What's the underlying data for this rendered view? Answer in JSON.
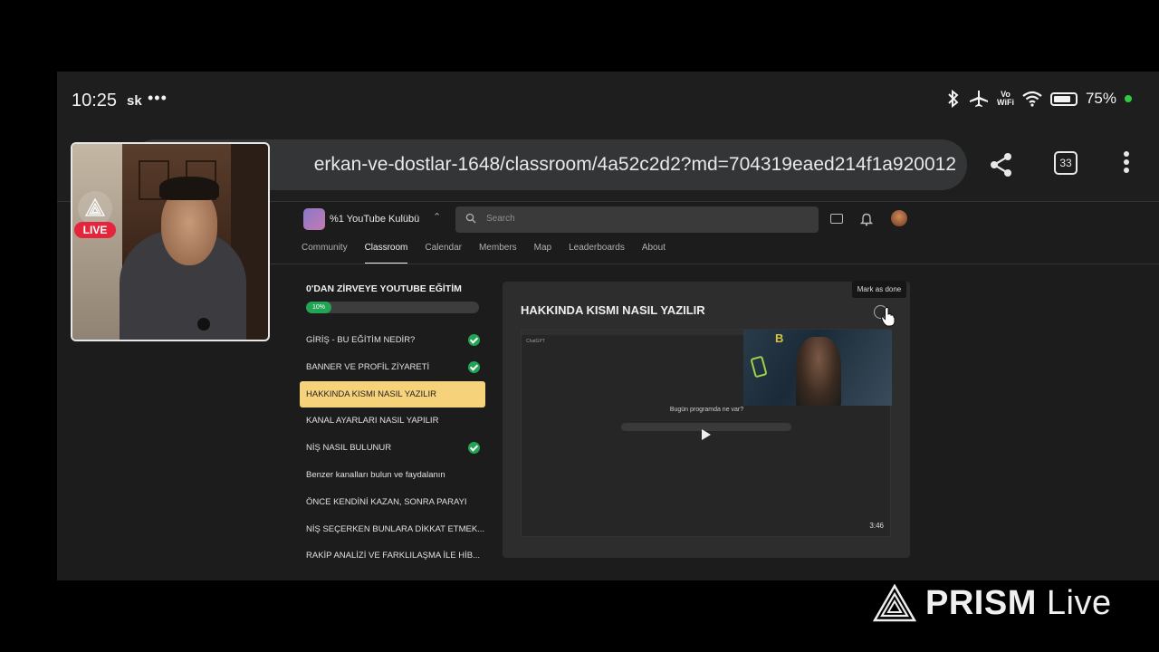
{
  "status_bar": {
    "time": "10:25",
    "app_indicator": "sk",
    "more": "•••",
    "network_label": "Vo\nWiFi",
    "battery_percent": "75%",
    "battery_level": 0.75,
    "icons": [
      "bluetooth-icon",
      "airplane-icon",
      "vowifi-icon",
      "wifi-icon",
      "battery-icon",
      "privacy-dot-icon"
    ]
  },
  "browser": {
    "url": "erkan-ve-dostlar-1648/classroom/4a52c2d2?md=704319eaed214f1a920012",
    "tab_count": "33",
    "icons": [
      "share-icon",
      "tabs-icon",
      "more-vert-icon"
    ]
  },
  "site": {
    "brand": "%1 YouTube Kulübü",
    "search_placeholder": "Search",
    "nav_tabs": [
      "Community",
      "Classroom",
      "Calendar",
      "Members",
      "Map",
      "Leaderboards",
      "About"
    ],
    "active_tab": "Classroom",
    "course": {
      "title": "0'DAN ZİRVEYE YOUTUBE EĞİTİM",
      "progress_label": "10%",
      "progress": 0.1
    },
    "lessons": [
      {
        "title": "GİRİŞ - BU EĞİTİM NEDİR?",
        "done": true,
        "active": false
      },
      {
        "title": "BANNER VE PROFİL ZİYARETİ",
        "done": true,
        "active": false
      },
      {
        "title": "HAKKINDA KISMI NASIL YAZILIR",
        "done": false,
        "active": true
      },
      {
        "title": "KANAL AYARLARI NASIL YAPILIR",
        "done": false,
        "active": false
      },
      {
        "title": "NİŞ NASIL BULUNUR",
        "done": true,
        "active": false
      },
      {
        "title": "Benzer kanalları bulun ve faydalanın",
        "done": false,
        "active": false
      },
      {
        "title": "ÖNCE KENDİNİ KAZAN, SONRA PARAYI",
        "done": false,
        "active": false
      },
      {
        "title": "NİŞ SEÇERKEN BUNLARA DİKKAT ETMEK...",
        "done": false,
        "active": false
      },
      {
        "title": "RAKİP ANALİZİ VE FARKLILAŞMA İLE HİB...",
        "done": false,
        "active": false
      }
    ],
    "lesson_card": {
      "title": "HAKKINDA KISMI NASIL YAZILIR",
      "mark_done_tooltip": "Mark as done",
      "video_prompt": "Bugün programda ne var?",
      "video_duration": "3:46",
      "video_facecam_letter": "B"
    }
  },
  "overlay": {
    "live_label": "LIVE",
    "watermark_brand": "PRISM",
    "watermark_suffix": "Live"
  },
  "colors": {
    "accent_green": "#22a455",
    "active_lesson": "#f6d27a",
    "live_red": "#e3263b"
  }
}
